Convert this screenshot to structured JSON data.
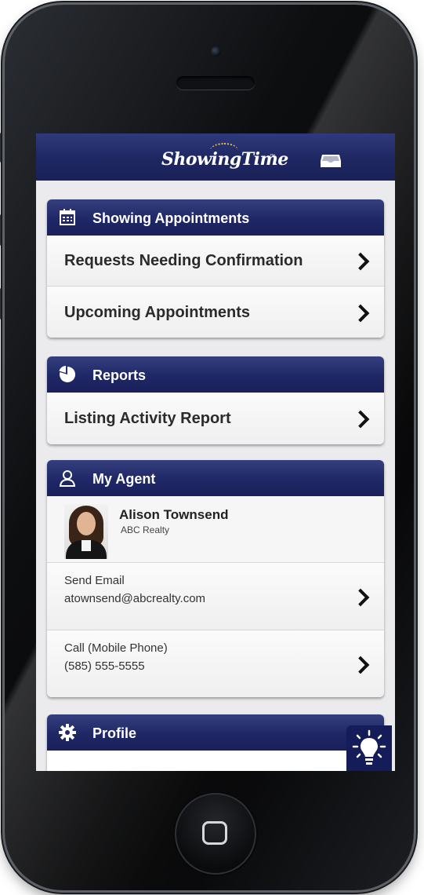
{
  "app": {
    "logo_text": "ShowingTime",
    "logo_tm": "™",
    "colors": {
      "header": "#1e2762",
      "accent": "#f3c23a",
      "card_bg": "#f6f6f7"
    }
  },
  "header": {
    "inbox_icon": "inbox-icon"
  },
  "showing_appointments": {
    "title": "Showing Appointments",
    "icon": "calendar-icon",
    "items": [
      {
        "label": "Requests Needing Confirmation"
      },
      {
        "label": "Upcoming Appointments"
      }
    ]
  },
  "reports": {
    "title": "Reports",
    "icon": "pie-chart-icon",
    "items": [
      {
        "label": "Listing Activity Report"
      }
    ]
  },
  "my_agent": {
    "title": "My Agent",
    "icon": "person-icon",
    "name": "Alison Townsend",
    "company": "ABC Realty",
    "email_label": "Send Email",
    "email": "atownsend@abcrealty.com",
    "phone_label": "Call (Mobile Phone)",
    "phone": "(585) 555-5555"
  },
  "profile": {
    "title": "Profile",
    "icon": "gear-icon"
  },
  "tip_button": {
    "icon": "lightbulb-icon"
  }
}
